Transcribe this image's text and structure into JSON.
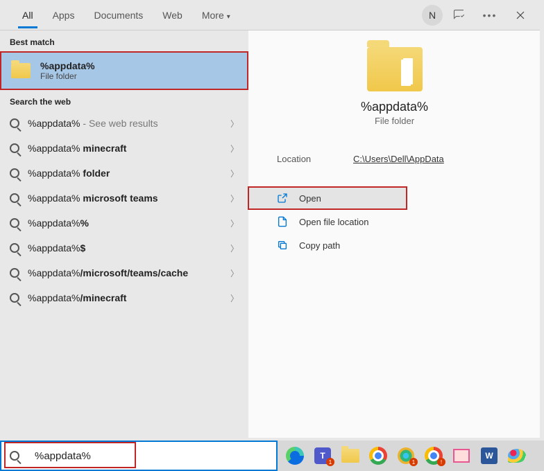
{
  "tabs": {
    "items": [
      "All",
      "Apps",
      "Documents",
      "Web",
      "More"
    ],
    "active_index": 0,
    "more_has_dropdown": true
  },
  "titlebar": {
    "avatar_initial": "N"
  },
  "sections": {
    "best_match_label": "Best match",
    "search_web_label": "Search the web"
  },
  "best_match": {
    "title": "%appdata%",
    "subtitle": "File folder"
  },
  "web_results": [
    {
      "prefix": "%appdata%",
      "suffix": "",
      "hint": " - See web results"
    },
    {
      "prefix": "%appdata%",
      "suffix": " minecraft",
      "hint": ""
    },
    {
      "prefix": "%appdata%",
      "suffix": " folder",
      "hint": ""
    },
    {
      "prefix": "%appdata%",
      "suffix": " microsoft teams",
      "hint": ""
    },
    {
      "prefix": "%appdata%",
      "suffix": "%",
      "hint": ""
    },
    {
      "prefix": "%appdata%",
      "suffix": "$",
      "hint": ""
    },
    {
      "prefix": "%appdata%",
      "suffix": "/microsoft/teams/cache",
      "hint": ""
    },
    {
      "prefix": "%appdata%",
      "suffix": "/minecraft",
      "hint": ""
    }
  ],
  "preview": {
    "title": "%appdata%",
    "subtitle": "File folder",
    "location_label": "Location",
    "location_value": "C:\\Users\\Dell\\AppData",
    "actions": [
      {
        "label": "Open",
        "icon": "open"
      },
      {
        "label": "Open file location",
        "icon": "filelocation"
      },
      {
        "label": "Copy path",
        "icon": "copypath"
      }
    ]
  },
  "searchbox": {
    "value": "%appdata%"
  },
  "taskbar_apps": [
    "edge",
    "teams",
    "explorer",
    "chrome",
    "slack",
    "chrome2",
    "snip",
    "word",
    "paint"
  ]
}
